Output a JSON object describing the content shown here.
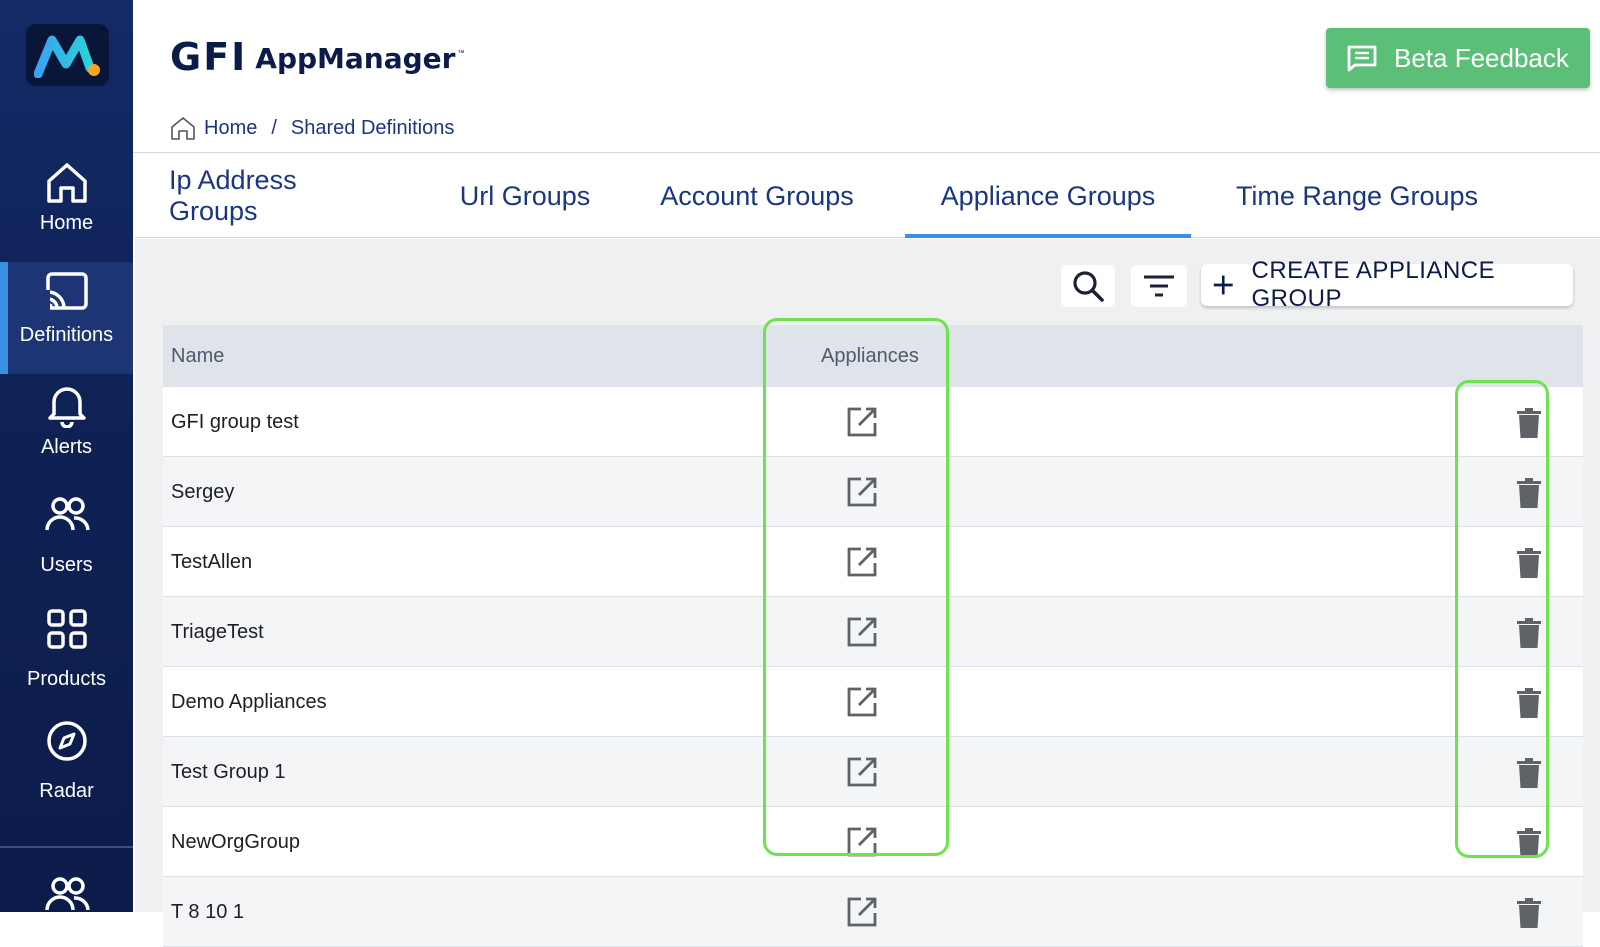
{
  "sidebar": {
    "items": [
      {
        "label": "Home",
        "icon": "home-icon"
      },
      {
        "label": "Definitions",
        "icon": "cast-icon"
      },
      {
        "label": "Alerts",
        "icon": "bell-icon"
      },
      {
        "label": "Users",
        "icon": "users-icon"
      },
      {
        "label": "Products",
        "icon": "grid-icon"
      },
      {
        "label": "Radar",
        "icon": "compass-icon"
      }
    ]
  },
  "header": {
    "brand_gfi": "GFI",
    "brand_app": "AppManager",
    "brand_tm": "™",
    "beta_label": "Beta Feedback"
  },
  "breadcrumb": {
    "home": "Home",
    "separator": "/",
    "current": "Shared Definitions"
  },
  "tabs": [
    {
      "label": "Ip Address Groups"
    },
    {
      "label": "Url Groups"
    },
    {
      "label": "Account Groups"
    },
    {
      "label": "Appliance Groups",
      "active": true
    },
    {
      "label": "Time Range Groups"
    }
  ],
  "toolbar": {
    "create_label": "CREATE APPLIANCE GROUP"
  },
  "table": {
    "columns": {
      "name": "Name",
      "appliances": "Appliances"
    },
    "rows": [
      {
        "name": "GFI group test"
      },
      {
        "name": "Sergey"
      },
      {
        "name": "TestAllen"
      },
      {
        "name": "TriageTest"
      },
      {
        "name": "Demo Appliances"
      },
      {
        "name": "Test Group 1"
      },
      {
        "name": "NewOrgGroup"
      },
      {
        "name": "T 8 10 1"
      }
    ]
  },
  "colors": {
    "sidebar": "#0f2257",
    "accent": "#3a8fe0",
    "beta_button": "#5cbf78",
    "highlight": "#6ee34f"
  }
}
